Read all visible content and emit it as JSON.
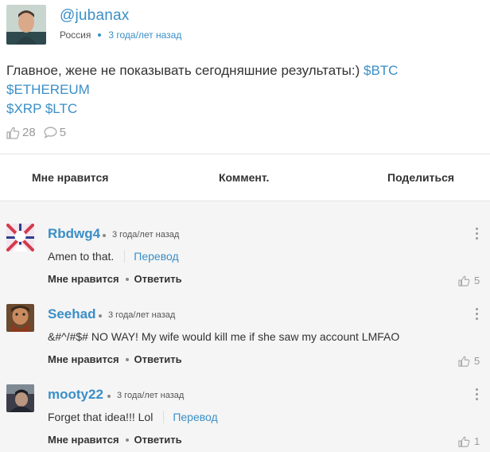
{
  "post": {
    "username": "@jubanax",
    "country": "Россия",
    "time": "3 года/лет назад",
    "text_main": "Главное, жене не показывать сегодняшние результаты:)",
    "tags_line1": "$BTC $ETHEREUM",
    "tags_line2": "$XRP $LTC",
    "likes": "28",
    "comments": "5"
  },
  "actions": {
    "like": "Мне нравится",
    "comment": "Коммент.",
    "share": "Поделиться"
  },
  "comments": [
    {
      "name": "Rbdwg4",
      "time": "3 года/лет назад",
      "text": "Amen to that.",
      "translate": "Перевод",
      "like_label": "Мне нравится",
      "reply_label": "Ответить",
      "likes": "5"
    },
    {
      "name": "Seehad",
      "time": "3 года/лет назад",
      "text": "&#^/#$# NO WAY! My wife would kill me if she saw my account LMFAO",
      "translate": "",
      "like_label": "Мне нравится",
      "reply_label": "Ответить",
      "likes": "5"
    },
    {
      "name": "mooty22",
      "time": "3 года/лет назад",
      "text": "Forget that idea!!! Lol",
      "translate": "Перевод",
      "like_label": "Мне нравится",
      "reply_label": "Ответить",
      "likes": "1"
    }
  ],
  "colors": {
    "link": "#3a8fc7",
    "muted": "#999999",
    "comment_bg": "#f5f5f5"
  },
  "icons": {
    "like": "thumbs-up-icon",
    "comment": "speech-bubble-icon",
    "more": "vertical-dots-icon"
  }
}
